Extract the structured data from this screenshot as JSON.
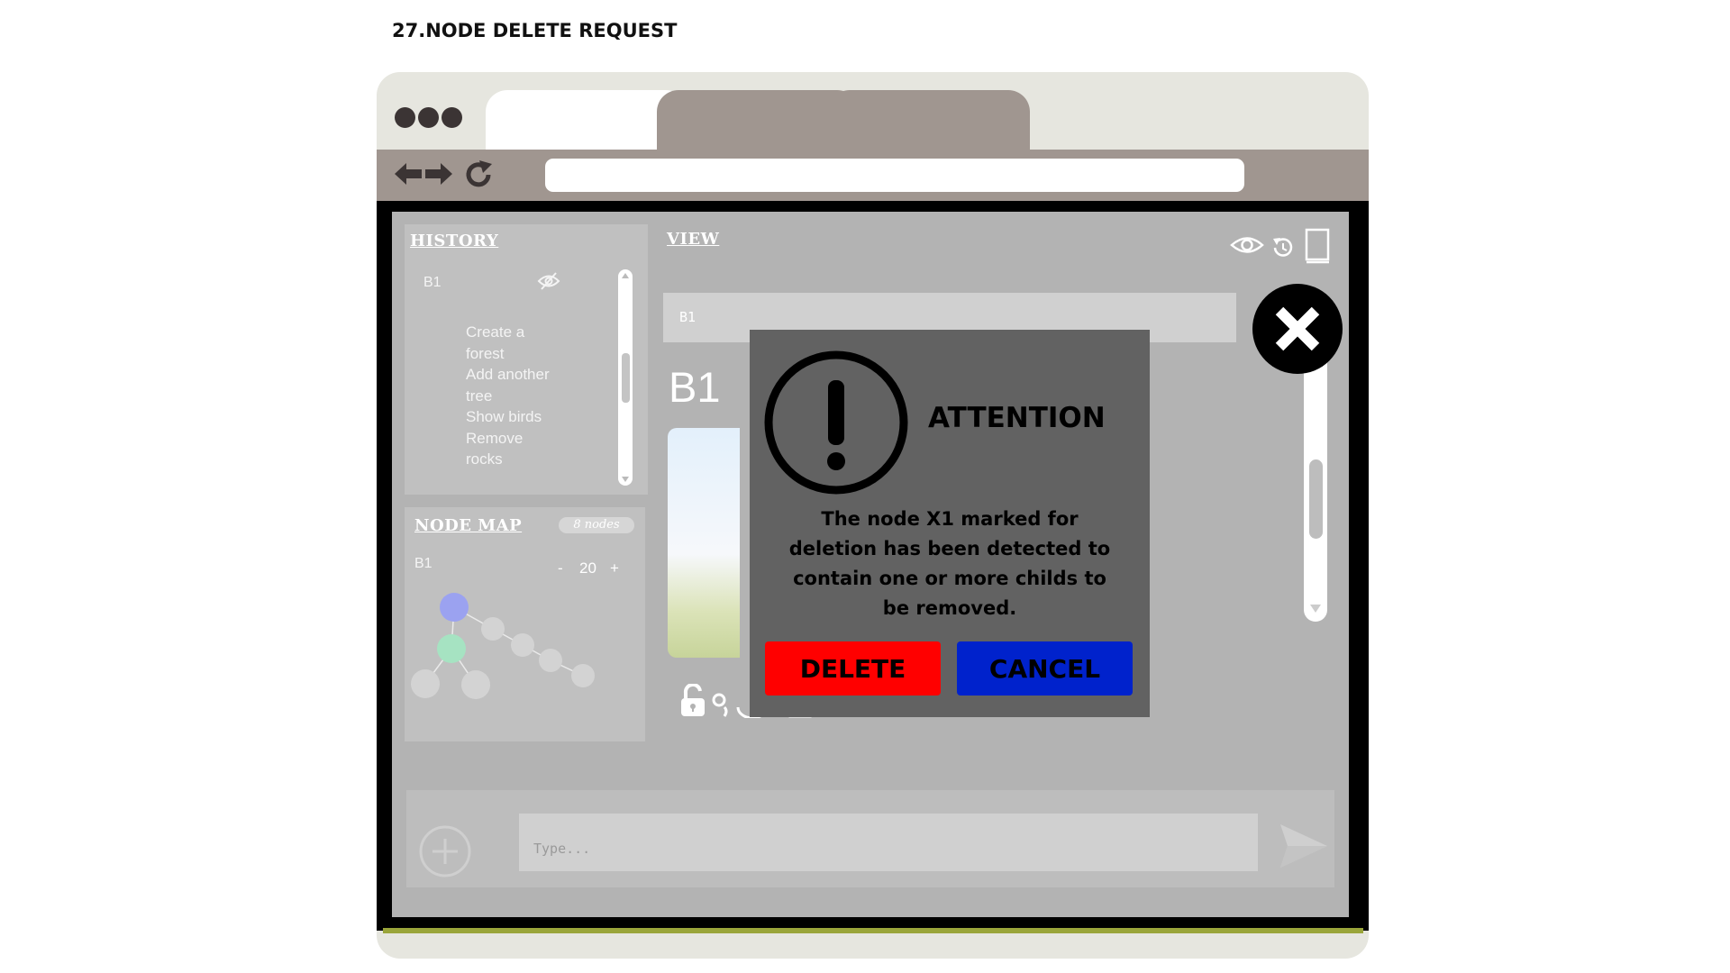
{
  "page_title": "27.NODE DELETE REQUEST",
  "browser": {
    "tabs": [
      {
        "label": ""
      },
      {
        "label": ""
      },
      {
        "label": ""
      }
    ],
    "address": ""
  },
  "history": {
    "title": "HISTORY",
    "node": "B1",
    "items": [
      "Create a",
      "forest",
      "Add another",
      "tree",
      "Show birds",
      "Remove",
      "rocks"
    ]
  },
  "node_map": {
    "title": "NODE MAP",
    "badge": "8 nodes",
    "node": "B1",
    "zoom_minus": "-",
    "zoom_value": "20",
    "zoom_plus": "+"
  },
  "view": {
    "title": "VIEW",
    "bar_text": "B1",
    "heading": "B1"
  },
  "chat": {
    "placeholder": "Type..."
  },
  "modal": {
    "title": "ATTENTION",
    "message": "The node X1 marked for deletion has been detected to contain one or more childs to be removed.",
    "delete_label": "DELETE",
    "cancel_label": "CANCEL"
  },
  "colors": {
    "delete": "#ff0000",
    "cancel": "#0022cc",
    "node_selected": "#9ba2f0",
    "node_active": "#a6e3c2"
  }
}
